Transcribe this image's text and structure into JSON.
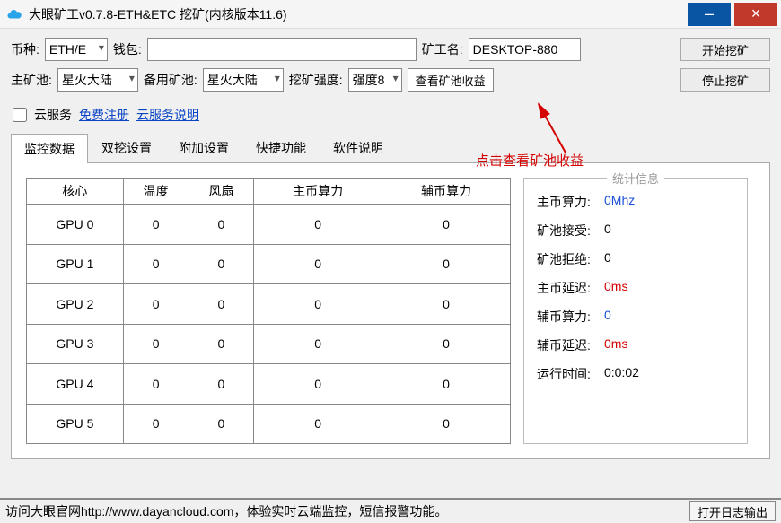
{
  "title": "大眼矿工v0.7.8-ETH&ETC 挖矿(内核版本11.6)",
  "labels": {
    "coin": "币种:",
    "wallet": "钱包:",
    "minerName": "矿工名:",
    "mainPool": "主矿池:",
    "backupPool": "备用矿池:",
    "intensity": "挖矿强度:",
    "cloudService": "云服务",
    "freeReg": "免费注册",
    "cloudDesc": "云服务说明"
  },
  "values": {
    "coinSelected": "ETH/E",
    "walletValue": "",
    "minerNameValue": "DESKTOP-880",
    "mainPoolSelected": "星火大陆",
    "backupPoolSelected": "星火大陆",
    "intensitySelected": "强度8"
  },
  "buttons": {
    "start": "开始挖矿",
    "stop": "停止挖矿",
    "viewProfit": "查看矿池收益",
    "openLog": "打开日志输出"
  },
  "annotation": "点击查看矿池收益",
  "tabs": [
    "监控数据",
    "双挖设置",
    "附加设置",
    "快捷功能",
    "软件说明"
  ],
  "tableHeaders": [
    "核心",
    "温度",
    "风扇",
    "主币算力",
    "辅币算力"
  ],
  "gpuRows": [
    {
      "core": "GPU 0",
      "temp": "0",
      "fan": "0",
      "hash": "0",
      "aux": "0"
    },
    {
      "core": "GPU 1",
      "temp": "0",
      "fan": "0",
      "hash": "0",
      "aux": "0"
    },
    {
      "core": "GPU 2",
      "temp": "0",
      "fan": "0",
      "hash": "0",
      "aux": "0"
    },
    {
      "core": "GPU 3",
      "temp": "0",
      "fan": "0",
      "hash": "0",
      "aux": "0"
    },
    {
      "core": "GPU 4",
      "temp": "0",
      "fan": "0",
      "hash": "0",
      "aux": "0"
    },
    {
      "core": "GPU 5",
      "temp": "0",
      "fan": "0",
      "hash": "0",
      "aux": "0"
    }
  ],
  "stats": {
    "legend": "统计信息",
    "mainHashLabel": "主币算力:",
    "mainHashValue": "0Mhz",
    "poolAcceptLabel": "矿池接受:",
    "poolAcceptValue": "0",
    "poolRejectLabel": "矿池拒绝:",
    "poolRejectValue": "0",
    "mainLatLabel": "主币延迟:",
    "mainLatValue": "0ms",
    "auxHashLabel": "辅币算力:",
    "auxHashValue": "0",
    "auxLatLabel": "辅币延迟:",
    "auxLatValue": "0ms",
    "runtimeLabel": "运行时间:",
    "runtimeValue": "0:0:02"
  },
  "footer": {
    "text": "访问大眼官网http://www.dayancloud.com，体验实时云端监控，短信报警功能。"
  }
}
